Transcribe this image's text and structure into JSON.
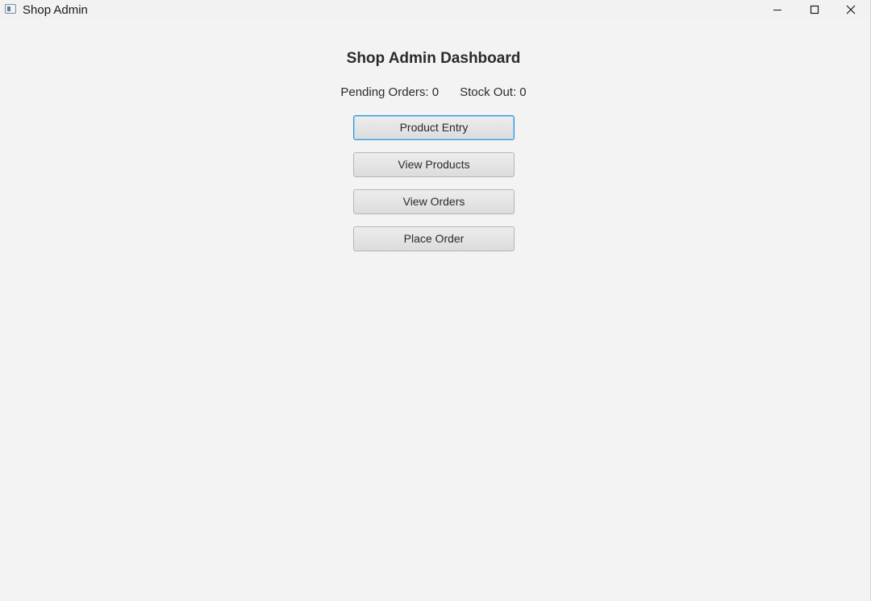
{
  "window": {
    "title": "Shop Admin",
    "icons": {
      "app": "app-window-icon",
      "minimize": "minimize-icon",
      "maximize": "maximize-icon",
      "close": "close-icon"
    }
  },
  "dashboard": {
    "heading": "Shop Admin Dashboard",
    "pending_orders": "Pending Orders: 0",
    "stock_out": "Stock Out: 0",
    "buttons": {
      "product_entry": "Product Entry",
      "view_products": "View Products",
      "view_orders": "View Orders",
      "place_order": "Place Order"
    }
  },
  "colors": {
    "background": "#f3f3f3",
    "focus_accent": "#2a95d6",
    "text": "#2b2b2b"
  }
}
